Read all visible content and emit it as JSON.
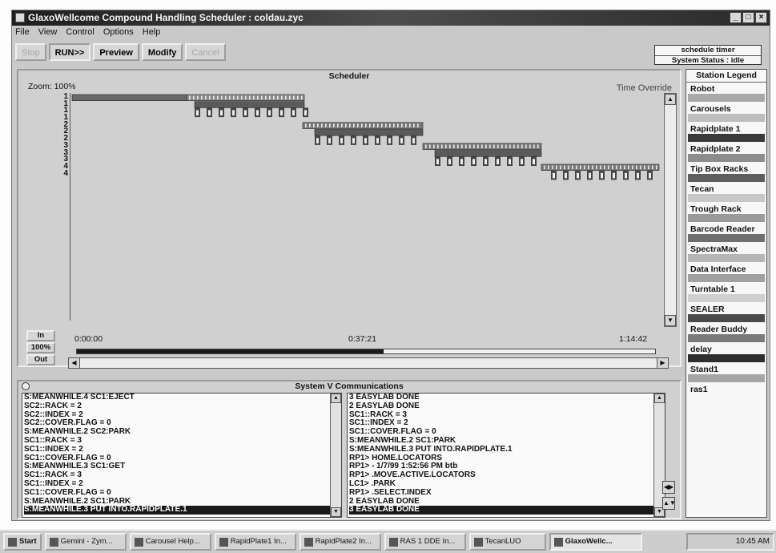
{
  "window": {
    "title": "GlaxoWellcome Compound Handling Scheduler : coldau.zyc"
  },
  "menu": [
    "File",
    "View",
    "Control",
    "Options",
    "Help"
  ],
  "toolbar": {
    "stop": "Stop",
    "run": "RUN>>",
    "preview": "Preview",
    "modify": "Modify",
    "cancel": "Cancel"
  },
  "status": {
    "timer": "schedule timer",
    "system": "System Status : idle"
  },
  "scheduler": {
    "title": "Scheduler",
    "zoom_label": "Zoom: 100%",
    "time_override": "Time Override",
    "rows": [
      "1",
      "1",
      "1",
      "1",
      "2",
      "2",
      "2",
      "3",
      "3",
      "3",
      "4",
      "4"
    ],
    "zoom_buttons": [
      "In",
      "100%",
      "Out"
    ],
    "time_labels": [
      "0:00:00",
      "0:37:21",
      "1:14:42"
    ],
    "timeline_progress": 0.53
  },
  "legend": {
    "title": "Station Legend",
    "items": [
      {
        "name": "Robot",
        "color": "#a9a9a9"
      },
      {
        "name": "Carousels",
        "color": "#bdbdbd"
      },
      {
        "name": "Rapidplate 1",
        "color": "#3a3a3a"
      },
      {
        "name": "Rapidplate 2",
        "color": "#8c8c8c"
      },
      {
        "name": "Tip Box Racks",
        "color": "#5e5e5e"
      },
      {
        "name": "Tecan",
        "color": "#c7c7c7"
      },
      {
        "name": "Trough Rack",
        "color": "#9a9a9a"
      },
      {
        "name": "Barcode Reader",
        "color": "#6e6e6e"
      },
      {
        "name": "SpectraMax",
        "color": "#b5b5b5"
      },
      {
        "name": "Data Interface",
        "color": "#a0a0a0"
      },
      {
        "name": "Turntable 1",
        "color": "#cfcfcf"
      },
      {
        "name": "SEALER",
        "color": "#4a4a4a"
      },
      {
        "name": "Reader Buddy",
        "color": "#7a7a7a"
      },
      {
        "name": "delay",
        "color": "#2e2e2e"
      },
      {
        "name": "Stand1",
        "color": "#a5a5a5"
      },
      {
        "name": "ras1",
        "color": ""
      }
    ]
  },
  "comm": {
    "title": "System V Communications",
    "left_log": [
      "S:MEANWHILE.4 SC1:EJECT",
      "SC2::RACK = 2",
      "SC2::INDEX = 2",
      "SC2::COVER.FLAG = 0",
      "S:MEANWHILE.2 SC2:PARK",
      "SC1::RACK = 3",
      "SC1::INDEX = 2",
      "SC1::COVER.FLAG = 0",
      "S:MEANWHILE.3 SC1:GET",
      "SC1::RACK = 3",
      "SC1::INDEX = 2",
      "SC1::COVER.FLAG = 0",
      "S:MEANWHILE.2 SC1:PARK",
      "S:MEANWHILE.3 PUT INTO.RAPIDPLATE.1"
    ],
    "right_log": [
      "3 EASYLAB DONE",
      "2 EASYLAB DONE",
      "SC1::RACK = 3",
      "SC1::INDEX = 2",
      "SC1::COVER.FLAG = 0",
      "S:MEANWHILE.2 SC1:PARK",
      "S:MEANWHILE.3 PUT INTO.RAPIDPLATE.1",
      "RP1> HOME.LOCATORS",
      "RP1>      - 1/7/99 1:52:56 PM    btb",
      "RP1>          .MOVE.ACTIVE.LOCATORS",
      "LC1> .PARK",
      "RP1> .SELECT.INDEX",
      "2 EASYLAB DONE",
      "3 EASYLAB DONE"
    ]
  },
  "taskbar": {
    "items": [
      "Start",
      "Gemini - Zym...",
      "Carousel Help...",
      "RapidPlate1 In...",
      "RapidPlate2 In...",
      "RAS 1 DDE In...",
      "TecanLUO",
      "GlaxoWellc..."
    ],
    "clock": "10:45 AM"
  }
}
